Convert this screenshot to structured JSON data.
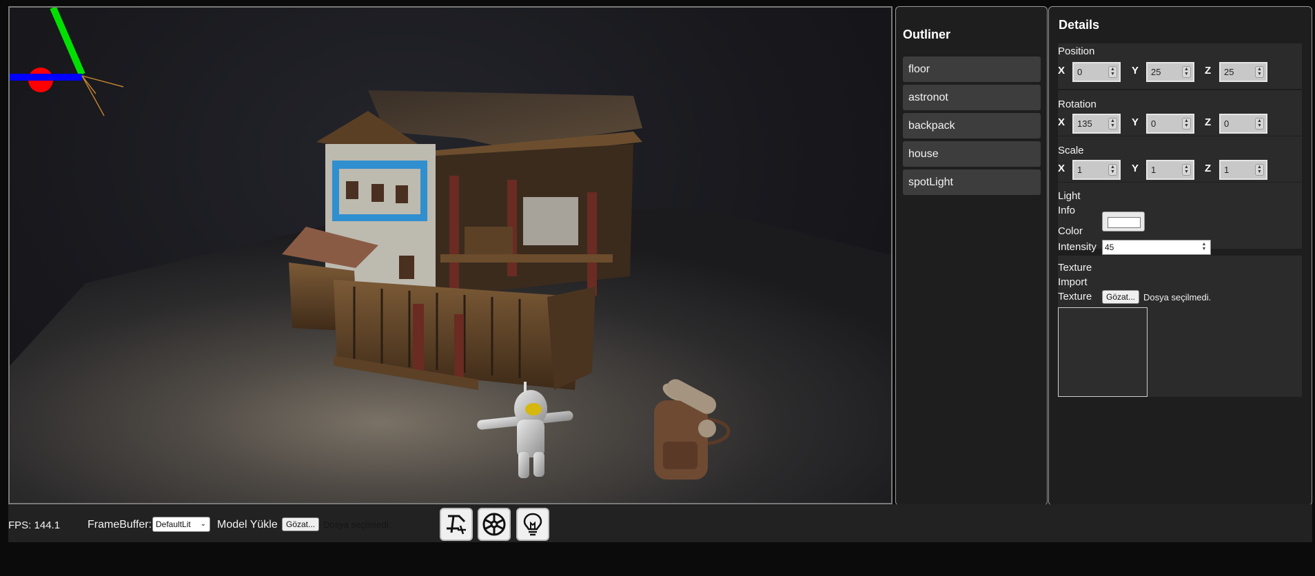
{
  "outliner": {
    "title": "Outliner",
    "items": [
      {
        "label": "floor"
      },
      {
        "label": "astronot"
      },
      {
        "label": "backpack"
      },
      {
        "label": "house"
      },
      {
        "label": "spotLight"
      }
    ]
  },
  "details": {
    "title": "Details",
    "position": {
      "label": "Position",
      "x": "0",
      "y": "25",
      "z": "25"
    },
    "rotation": {
      "label": "Rotation",
      "x": "135",
      "y": "0",
      "z": "0"
    },
    "scale": {
      "label": "Scale",
      "x": "1",
      "y": "1",
      "z": "1"
    },
    "axis_x": "X",
    "axis_y": "Y",
    "axis_z": "Z",
    "light": {
      "label_line1": "Light",
      "label_line2": "Info",
      "color_label": "Color",
      "color_value": "#ffffff",
      "intensity_label": "Intensity",
      "intensity_value": "45"
    },
    "texture": {
      "label_line1": "Texture",
      "label_line2": "Import",
      "field_label": "Texture",
      "browse_label": "Gözat...",
      "no_file": "Dosya seçilmedi."
    }
  },
  "bottombar": {
    "fps": "FPS: 144.1",
    "framebuffer_label": "FrameBuffer:",
    "framebuffer_value": "DefaultLit",
    "model_label": "Model Yükle",
    "browse_label": "Gözat...",
    "no_file": "Dosya seçilmedi.",
    "tools": [
      {
        "icon": "translate-gizmo-icon"
      },
      {
        "icon": "wheel-icon"
      },
      {
        "icon": "light-bulb-icon"
      }
    ]
  },
  "viewport": {
    "gizmo_colors": {
      "x": "#0000ff",
      "y": "#00e000",
      "z": "#ff0000"
    }
  }
}
